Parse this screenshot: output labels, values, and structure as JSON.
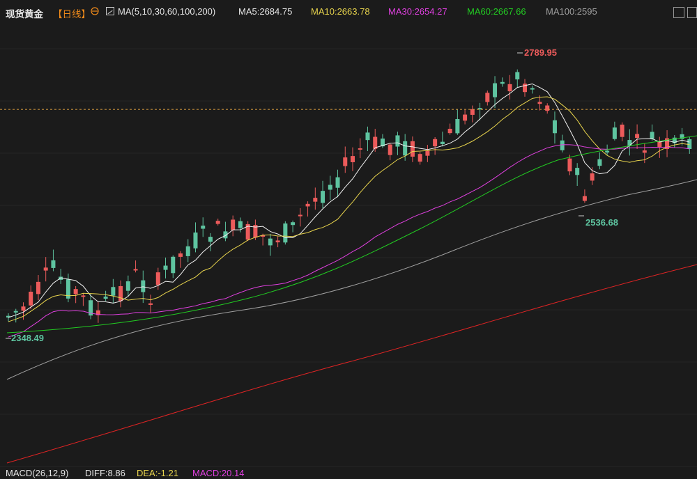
{
  "header": {
    "title": "现货黄金",
    "period": "【日线】",
    "ma_label": "MA(5,10,30,60,100,200)",
    "ma5": "MA5:2684.75",
    "ma10": "MA10:2663.78",
    "ma30": "MA30:2654.27",
    "ma60": "MA60:2667.66",
    "ma100": "MA100:2595"
  },
  "footer": {
    "macd_label": "MACD(26,12,9)",
    "diff": "DIFF:8.86",
    "dea": "DEA:-1.21",
    "macd": "MACD:20.14"
  },
  "colors": {
    "background": "#1b1b1b",
    "up": "#ec5b5b",
    "down": "#5ec4a0",
    "ma5": "#f0f0f0",
    "ma10": "#e8d44d",
    "ma30": "#e040e0",
    "ma60": "#22cc22",
    "ma100": "#a0a0a0",
    "ma200": "#e02424",
    "ref_line": "#e0a040",
    "high_label": "#ec5b5b",
    "low_label": "#5ec4a0"
  },
  "chart_data": {
    "type": "candlestick",
    "title": "现货黄金 日线",
    "y_range": [
      2440,
      2810
    ],
    "annotations": [
      {
        "text": "2789.95",
        "kind": "high"
      },
      {
        "text": "2536.68",
        "kind": "low"
      },
      {
        "text": "2348.49",
        "kind": "low"
      }
    ],
    "reference_price": 2741
  }
}
